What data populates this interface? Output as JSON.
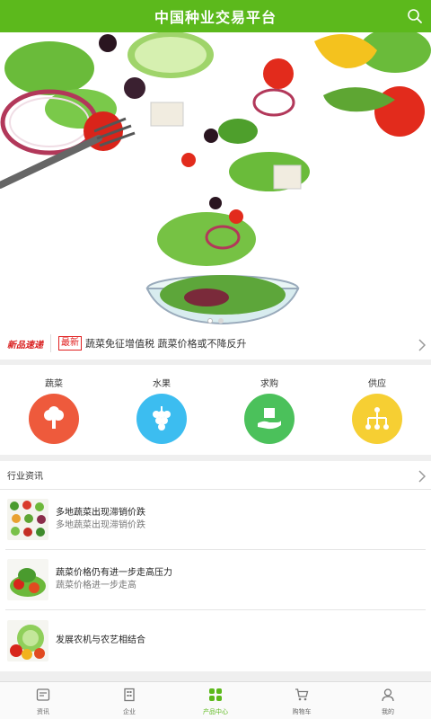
{
  "header": {
    "title": "中国种业交易平台",
    "search_icon": "search-icon"
  },
  "banner": {
    "image": "salad-bowl-banner",
    "slides": 2,
    "active_slide": 1
  },
  "ticker": {
    "brand": "新品速递",
    "badge": "最新",
    "text": "蔬菜免征增值税 蔬菜价格或不降反升"
  },
  "categories": [
    {
      "label": "蔬菜",
      "icon": "vegetable-icon",
      "color": "#ee5a3c"
    },
    {
      "label": "水果",
      "icon": "grape-icon",
      "color": "#3cbdf0"
    },
    {
      "label": "求购",
      "icon": "hand-box-icon",
      "color": "#4bc15b"
    },
    {
      "label": "供应",
      "icon": "org-chart-icon",
      "color": "#f6cf33"
    }
  ],
  "news": {
    "title": "行业资讯",
    "items": [
      {
        "title": "多地蔬菜出现滞销价跌",
        "subtitle": "多地蔬菜出现滞销价跌"
      },
      {
        "title": "蔬菜价格仍有进一步走高压力",
        "subtitle": "蔬菜价格进一步走高"
      },
      {
        "title": "发展农机与农艺相结合",
        "subtitle": ""
      }
    ]
  },
  "nav": [
    {
      "label": "资讯",
      "icon": "news-icon"
    },
    {
      "label": "企业",
      "icon": "building-icon"
    },
    {
      "label": "产品中心",
      "icon": "grid-icon",
      "active": true
    },
    {
      "label": "购物车",
      "icon": "cart-icon"
    },
    {
      "label": "我的",
      "icon": "user-icon"
    }
  ],
  "colors": {
    "brand": "#5cb91c",
    "accent_red": "#e02020"
  }
}
